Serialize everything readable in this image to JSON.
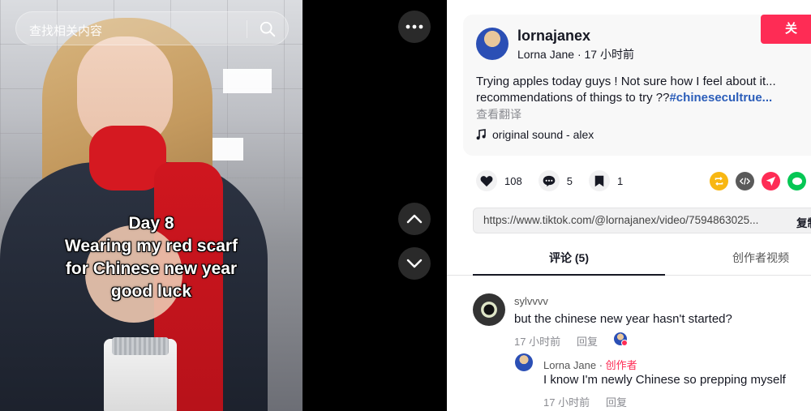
{
  "search": {
    "placeholder": "查找相关内容"
  },
  "video": {
    "caption_lines": [
      "Day 8",
      "Wearing my red scarf",
      "for Chinese new year",
      "good luck"
    ]
  },
  "author": {
    "username": "lornajanex",
    "display_name": "Lorna Jane",
    "time_ago": "17 小时前",
    "follow_label": "关"
  },
  "description": {
    "line1": "Trying apples today guys ! Not sure how I feel about it...",
    "line2_text": "recommendations of things to try ??",
    "line2_hashtag": "#chinesecultrue...",
    "see_translation": "查看翻译",
    "sound": "original sound - alex"
  },
  "actions": {
    "likes": "108",
    "comments": "5",
    "saves": "1"
  },
  "share": {
    "colors": {
      "repost": "#f8b712",
      "embed": "#5a5a5a",
      "send": "#fe2c55",
      "line": "#06c755"
    },
    "link": "https://www.tiktok.com/@lornajanex/video/7594863025...",
    "copy_label": "复制"
  },
  "tabs": {
    "comments": "评论 (5)",
    "creator_videos": "创作者视频"
  },
  "comments": [
    {
      "username": "sylvvvv",
      "text": "but the chinese new year hasn't started?",
      "time_ago": "17 小时前",
      "reply_label": "回复"
    },
    {
      "username": "Lorna Jane",
      "creator_tag": "创作者",
      "text": "I know I'm newly Chinese so prepping myself",
      "time_ago": "17 小时前",
      "reply_label": "回复"
    }
  ],
  "colors": {
    "accent": "#fe2c55",
    "hashtag": "#2b5db9",
    "panel_bg": "#ffffff"
  }
}
